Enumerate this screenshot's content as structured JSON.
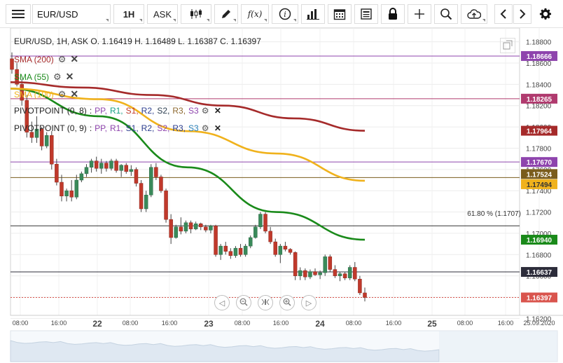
{
  "toolbar": {
    "symbol": "EUR/USD",
    "timeframe": "1H",
    "price_side": "ASK",
    "fx_label": "f(x)"
  },
  "header": {
    "text": "EUR/USD, 1H, ASK   O. 1.16419 H. 1.16489 L. 1.16387 C. 1.16397"
  },
  "indicators": [
    {
      "label": "SMA (200)",
      "color": "#a52a2a"
    },
    {
      "label": "SMA (55)",
      "color": "#1a8a1a"
    },
    {
      "label": "SMA (100)",
      "color": "#f0b21c"
    }
  ],
  "pivots": [
    {
      "prefix": "PIVOTPOINT (0, 8)",
      "items": [
        {
          "t": "PP,",
          "c": "#8e44ad"
        },
        {
          "t": "R1,",
          "c": "#16a085"
        },
        {
          "t": "S1,",
          "c": "#c0392b"
        },
        {
          "t": "R2,",
          "c": "#2c3e8f"
        },
        {
          "t": "S2,",
          "c": "#2c3e50"
        },
        {
          "t": "R3,",
          "c": "#8e6a30"
        },
        {
          "t": "S3",
          "c": "#8e44ad"
        }
      ]
    },
    {
      "prefix": "PIVOTPOINT (0, 9)",
      "items": [
        {
          "t": "PP,",
          "c": "#8e44ad"
        },
        {
          "t": "R1,",
          "c": "#8e44ad"
        },
        {
          "t": "S1,",
          "c": "#2c3e8f"
        },
        {
          "t": "R2,",
          "c": "#2c3e8f"
        },
        {
          "t": "S2,",
          "c": "#8e44ad"
        },
        {
          "t": "R3,",
          "c": "#2c3e8f"
        },
        {
          "t": "S3",
          "c": "#2980b9"
        }
      ]
    }
  ],
  "fib_label": "61.80 % (1.1707)",
  "chart_data": {
    "type": "candlestick",
    "y_ticks": [
      "1.18800",
      "1.18600",
      "1.18400",
      "1.18200",
      "1.18000",
      "1.17800",
      "1.17600",
      "1.17400",
      "1.17200",
      "1.17000",
      "1.16800",
      "1.16600",
      "1.16400",
      "1.16200"
    ],
    "x_ticks": [
      "08:00",
      "16:00",
      "22",
      "08:00",
      "16:00",
      "23",
      "08:00",
      "16:00",
      "24",
      "08:00",
      "16:00",
      "25",
      "08:00",
      "16:00",
      "25.09.2020"
    ],
    "price_tags": [
      {
        "label": "1.18666",
        "value": 1.18666,
        "bg": "#8e44ad",
        "fg": "#ffffff"
      },
      {
        "label": "1.18265",
        "value": 1.18265,
        "bg": "#b03a6e",
        "fg": "#ffffff"
      },
      {
        "label": "1.17964",
        "value": 1.17964,
        "bg": "#a52a2a",
        "fg": "#ffffff"
      },
      {
        "label": "1.17670",
        "value": 1.1767,
        "bg": "#8e44ad",
        "fg": "#ffffff"
      },
      {
        "label": "1.17524",
        "value": 1.17524,
        "bg": "#7a5c1c",
        "fg": "#ffffff"
      },
      {
        "label": "1.17494",
        "value": 1.17494,
        "bg": "#f0b21c",
        "fg": "#333333"
      },
      {
        "label": "1.16940",
        "value": 1.1694,
        "bg": "#1a8a1a",
        "fg": "#ffffff"
      },
      {
        "label": "1.16637",
        "value": 1.16637,
        "bg": "#2c2c3a",
        "fg": "#ffffff"
      },
      {
        "label": "1.16397",
        "value": 1.16397,
        "bg": "#d9544d",
        "fg": "#ffffff"
      }
    ],
    "horizontal_lines": [
      {
        "value": 1.18666,
        "color": "#8e44ad"
      },
      {
        "value": 1.18265,
        "color": "#b03a6e"
      },
      {
        "value": 1.1767,
        "color": "#8e44ad"
      },
      {
        "value": 1.17524,
        "color": "#7a5c1c"
      },
      {
        "value": 1.1707,
        "color": "#333333"
      },
      {
        "value": 1.16637,
        "color": "#2c2c3a"
      },
      {
        "value": 1.16397,
        "color": "#d9544d",
        "dashed": true
      }
    ],
    "candles": [
      [
        1.1864,
        1.187,
        1.185,
        1.1854
      ],
      [
        1.1854,
        1.186,
        1.1838,
        1.184
      ],
      [
        1.184,
        1.1845,
        1.182,
        1.1825
      ],
      [
        1.1825,
        1.183,
        1.179,
        1.1795
      ],
      [
        1.1795,
        1.1805,
        1.1785,
        1.179
      ],
      [
        1.179,
        1.181,
        1.1785,
        1.1798
      ],
      [
        1.1798,
        1.18,
        1.1778,
        1.1782
      ],
      [
        1.1782,
        1.1795,
        1.178,
        1.1792
      ],
      [
        1.1792,
        1.1796,
        1.176,
        1.1765
      ],
      [
        1.1765,
        1.177,
        1.1745,
        1.1748
      ],
      [
        1.1748,
        1.1755,
        1.173,
        1.1735
      ],
      [
        1.1735,
        1.1742,
        1.173,
        1.174
      ],
      [
        1.174,
        1.175,
        1.173,
        1.1734
      ],
      [
        1.1734,
        1.1755,
        1.1732,
        1.175
      ],
      [
        1.175,
        1.1758,
        1.1748,
        1.1756
      ],
      [
        1.1756,
        1.1765,
        1.1753,
        1.1762
      ],
      [
        1.1762,
        1.177,
        1.1757,
        1.1768
      ],
      [
        1.1768,
        1.1772,
        1.1758,
        1.1761
      ],
      [
        1.1761,
        1.177,
        1.1756,
        1.1766
      ],
      [
        1.1766,
        1.1768,
        1.1758,
        1.1761
      ],
      [
        1.1761,
        1.177,
        1.1759,
        1.1768
      ],
      [
        1.1768,
        1.177,
        1.1757,
        1.1759
      ],
      [
        1.1759,
        1.1765,
        1.1753,
        1.1764
      ],
      [
        1.1764,
        1.1766,
        1.1756,
        1.1758
      ],
      [
        1.1758,
        1.1764,
        1.1754,
        1.176
      ],
      [
        1.176,
        1.1762,
        1.1744,
        1.1747
      ],
      [
        1.1747,
        1.175,
        1.172,
        1.1723
      ],
      [
        1.1723,
        1.174,
        1.172,
        1.1736
      ],
      [
        1.1736,
        1.1765,
        1.1734,
        1.1762
      ],
      [
        1.1762,
        1.1766,
        1.175,
        1.1753
      ],
      [
        1.1753,
        1.1755,
        1.1738,
        1.174
      ],
      [
        1.174,
        1.1742,
        1.171,
        1.1713
      ],
      [
        1.1713,
        1.1718,
        1.169,
        1.1696
      ],
      [
        1.1696,
        1.1708,
        1.1695,
        1.1706
      ],
      [
        1.1706,
        1.1715,
        1.1699,
        1.1702
      ],
      [
        1.1702,
        1.1712,
        1.17,
        1.171
      ],
      [
        1.171,
        1.1712,
        1.17,
        1.1704
      ],
      [
        1.1704,
        1.1711,
        1.1703,
        1.1709
      ],
      [
        1.1709,
        1.171,
        1.1703,
        1.1706
      ],
      [
        1.1706,
        1.1708,
        1.1701,
        1.1703
      ],
      [
        1.1703,
        1.1708,
        1.17,
        1.1707
      ],
      [
        1.1707,
        1.1708,
        1.1678,
        1.168
      ],
      [
        1.168,
        1.169,
        1.1675,
        1.1688
      ],
      [
        1.1688,
        1.1692,
        1.168,
        1.1683
      ],
      [
        1.1683,
        1.1686,
        1.1676,
        1.1679
      ],
      [
        1.1679,
        1.1688,
        1.1677,
        1.1686
      ],
      [
        1.1686,
        1.169,
        1.1678,
        1.168
      ],
      [
        1.168,
        1.169,
        1.1678,
        1.1688
      ],
      [
        1.1688,
        1.1698,
        1.1686,
        1.1696
      ],
      [
        1.1696,
        1.1708,
        1.1695,
        1.1706
      ],
      [
        1.1706,
        1.172,
        1.1704,
        1.1718
      ],
      [
        1.1718,
        1.172,
        1.17,
        1.1702
      ],
      [
        1.1702,
        1.1706,
        1.169,
        1.1692
      ],
      [
        1.1692,
        1.1695,
        1.1678,
        1.168
      ],
      [
        1.168,
        1.169,
        1.1672,
        1.1688
      ],
      [
        1.1688,
        1.1692,
        1.1683,
        1.1685
      ],
      [
        1.1685,
        1.1686,
        1.168,
        1.1682
      ],
      [
        1.1682,
        1.1683,
        1.1656,
        1.166
      ],
      [
        1.166,
        1.1668,
        1.1656,
        1.1665
      ],
      [
        1.1665,
        1.1667,
        1.1656,
        1.1659
      ],
      [
        1.1659,
        1.1666,
        1.1657,
        1.1664
      ],
      [
        1.1664,
        1.1667,
        1.166,
        1.1661
      ],
      [
        1.1661,
        1.1665,
        1.1657,
        1.1663
      ],
      [
        1.1663,
        1.168,
        1.166,
        1.1678
      ],
      [
        1.1678,
        1.168,
        1.1664,
        1.1666
      ],
      [
        1.1666,
        1.167,
        1.1658,
        1.166
      ],
      [
        1.166,
        1.1664,
        1.1655,
        1.1662
      ],
      [
        1.1662,
        1.1664,
        1.1656,
        1.1658
      ],
      [
        1.1658,
        1.167,
        1.1656,
        1.1668
      ],
      [
        1.1668,
        1.1673,
        1.1655,
        1.1657
      ],
      [
        1.1657,
        1.166,
        1.1642,
        1.1644
      ],
      [
        1.1644,
        1.1649,
        1.1636,
        1.16397
      ]
    ],
    "sma200": [
      1.1842,
      1.1837,
      1.183,
      1.182,
      1.1808,
      1.17964
    ],
    "sma55": [
      1.1836,
      1.181,
      1.1762,
      1.172,
      1.1694
    ],
    "sma100": [
      1.1836,
      1.1826,
      1.1796,
      1.1775,
      1.17494
    ]
  }
}
